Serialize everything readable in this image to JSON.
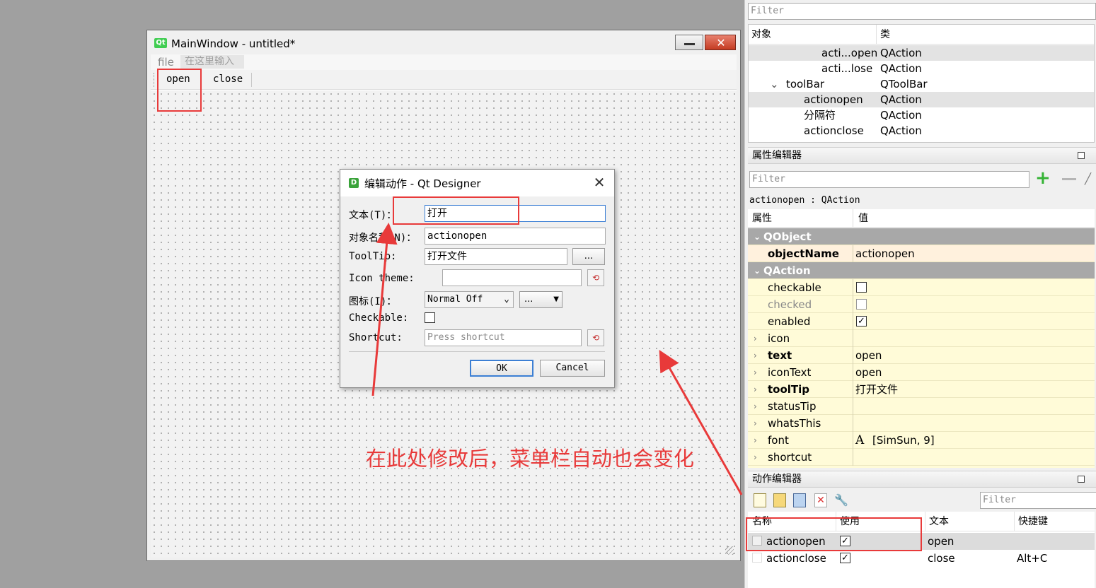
{
  "main_window": {
    "logo": "Qt",
    "title": "MainWindow - untitled*",
    "close_glyph": "✕",
    "menu": {
      "file": "file",
      "type_here": "在这里输入"
    },
    "toolbar": {
      "open": "open",
      "close": "close"
    }
  },
  "dialog": {
    "logo": "D",
    "title": "编辑动作 - Qt Designer",
    "close_glyph": "✕",
    "fields": {
      "text_label": "文本(T)：",
      "text_value": "打开",
      "objname_label": "对象名称(N)：",
      "objname_value": "actionopen",
      "tooltip_label": "ToolTip:",
      "tooltip_value": "打开文件",
      "tooltip_button": "...",
      "icontheme_label": "Icon theme:",
      "icon_label": "图标(I)：",
      "icon_mode": "Normal Off",
      "icon_button": "...",
      "checkable_label": "Checkable:",
      "shortcut_label": "Shortcut:",
      "shortcut_placeholder": "Press shortcut"
    },
    "ok": "OK",
    "cancel": "Cancel"
  },
  "object_inspector": {
    "filter_placeholder": "Filter",
    "col_object": "对象",
    "col_class": "类",
    "rows": [
      {
        "name": "acti...open",
        "cls": "QAction"
      },
      {
        "name": "acti...lose",
        "cls": "QAction"
      },
      {
        "name": "toolBar",
        "cls": "QToolBar"
      },
      {
        "name": "actionopen",
        "cls": "QAction"
      },
      {
        "name": "分隔符",
        "cls": "QAction"
      },
      {
        "name": "actionclose",
        "cls": "QAction"
      }
    ]
  },
  "property_editor": {
    "title": "属性编辑器",
    "filter_placeholder": "Filter",
    "context": "actionopen : QAction",
    "col_prop": "属性",
    "col_value": "值",
    "groups": {
      "qobject": "QObject",
      "qaction": "QAction"
    },
    "rows": {
      "objectName": {
        "name": "objectName",
        "value": "actionopen"
      },
      "checkable": {
        "name": "checkable"
      },
      "checked": {
        "name": "checked"
      },
      "enabled": {
        "name": "enabled"
      },
      "icon": {
        "name": "icon"
      },
      "text": {
        "name": "text",
        "value": "open"
      },
      "iconText": {
        "name": "iconText",
        "value": "open"
      },
      "toolTip": {
        "name": "toolTip",
        "value": "打开文件"
      },
      "statusTip": {
        "name": "statusTip"
      },
      "whatsThis": {
        "name": "whatsThis"
      },
      "font": {
        "name": "font",
        "value": "[SimSun, 9]",
        "glyph": "A"
      },
      "shortcut": {
        "name": "shortcut"
      }
    }
  },
  "action_editor": {
    "title": "动作编辑器",
    "filter_placeholder": "Filter",
    "cols": {
      "name": "名称",
      "used": "使用",
      "text": "文本",
      "shortcut": "快捷键"
    },
    "rows": [
      {
        "name": "actionopen",
        "text": "open",
        "shortcut": ""
      },
      {
        "name": "actionclose",
        "text": "close",
        "shortcut": "Alt+C"
      }
    ]
  },
  "annotation": "在此处修改后，菜单栏自动也会变化",
  "colors": {
    "annotation_red": "#e83a3a",
    "qt_green": "#41cd52"
  }
}
